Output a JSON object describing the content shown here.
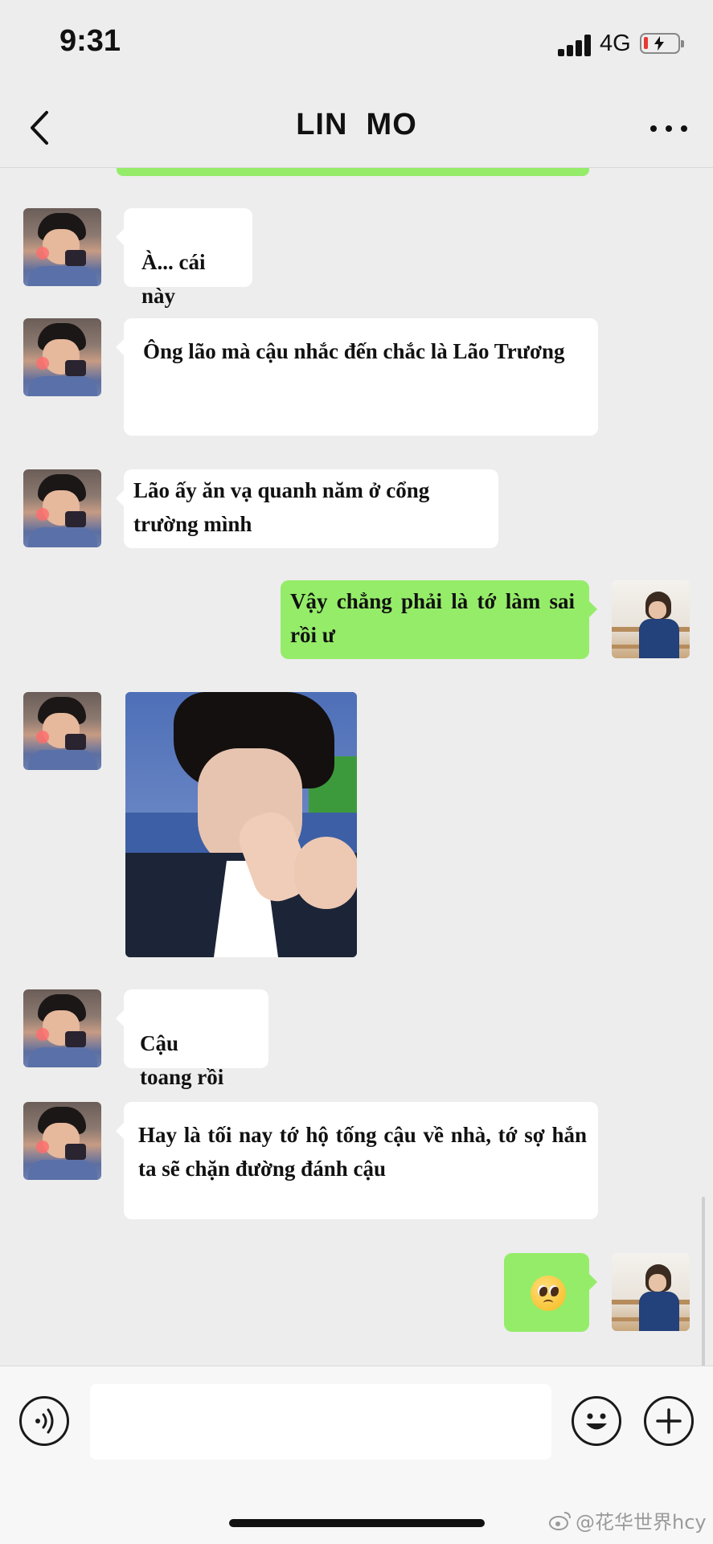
{
  "status_bar": {
    "time": "9:31",
    "network": "4G",
    "battery_state": "low, charging"
  },
  "nav": {
    "title": "LIN  MO",
    "back_icon": "chevron-left-icon",
    "more_icon": "more-dots-icon"
  },
  "messages": [
    {
      "side": "in",
      "type": "text",
      "avatar": "contact-avatar",
      "text": "À...  cái\nnày"
    },
    {
      "side": "in",
      "type": "text",
      "avatar": "contact-avatar",
      "text": "Ông lão mà cậu nhắc đến chắc là Lão Trương"
    },
    {
      "side": "in",
      "type": "text",
      "avatar": "contact-avatar",
      "text": "Lão ấy ăn vạ quanh năm ở cổng trường mình"
    },
    {
      "side": "out",
      "type": "text",
      "avatar": "user-avatar",
      "text": "Vậy chẳng phải là tớ làm sai rồi ư"
    },
    {
      "side": "in",
      "type": "image",
      "avatar": "contact-avatar",
      "image_desc": "sticker-photo"
    },
    {
      "side": "in",
      "type": "text",
      "avatar": "contact-avatar",
      "text": "Cậu\ntoang rồi"
    },
    {
      "side": "in",
      "type": "text",
      "avatar": "contact-avatar",
      "text": "Hay là tối nay tớ hộ tống cậu về nhà, tớ sợ hắn ta sẽ chặn đường đánh cậu"
    },
    {
      "side": "out",
      "type": "emoji",
      "avatar": "user-avatar",
      "emoji": "🥺"
    }
  ],
  "input_bar": {
    "message_placeholder": "",
    "voice_icon": "voice-icon",
    "emoji_icon": "emoji-face-icon",
    "plus_icon": "plus-icon"
  },
  "watermark": "@花华世界hcy",
  "colors": {
    "background": "#EDEDED",
    "outgoing_bubble": "#95EC69",
    "incoming_bubble": "#FFFFFF",
    "battery_low": "#E53935"
  }
}
